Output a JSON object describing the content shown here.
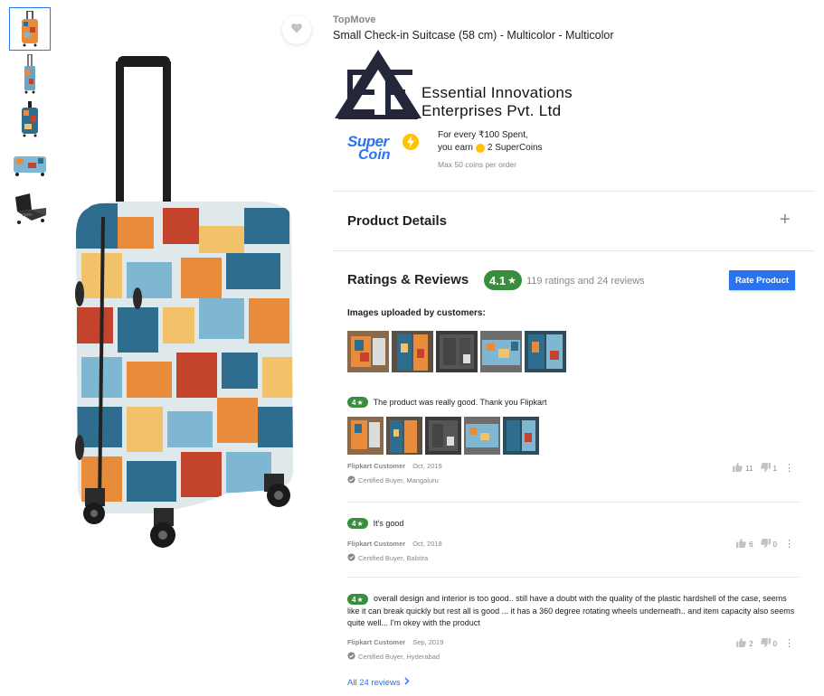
{
  "product": {
    "brand": "TopMove",
    "title": "Small Check-in Suitcase (58 cm) - Multicolor - Multicolor"
  },
  "seller": {
    "name_line1": "Essential Innovations",
    "name_line2": "Enterprises Pvt. Ltd"
  },
  "supercoin": {
    "logo_top": "Super",
    "logo_bottom": "Coin",
    "line1": "For every ₹100 Spent,",
    "line2_prefix": "you earn",
    "line2_suffix": "2 SuperCoins",
    "line3": "Max 50 coins per order"
  },
  "product_details": {
    "title": "Product Details",
    "expand_icon": "+"
  },
  "ratings": {
    "title": "Ratings & Reviews",
    "average": "4.1",
    "star": "★",
    "summary": "119 ratings and 24 reviews",
    "rate_button": "Rate Product",
    "images_label": "Images uploaded by customers:"
  },
  "reviews": [
    {
      "rating": "4",
      "text": "The product was really good. Thank you Flipkart",
      "author": "Flipkart Customer",
      "date": "Oct, 2019",
      "certified": "Certified Buyer, Mangaluru",
      "likes": "11",
      "dislikes": "1"
    },
    {
      "rating": "4",
      "text": "It's good",
      "author": "Flipkart Customer",
      "date": "Oct, 2018",
      "certified": "Certified Buyer, Balotra",
      "likes": "6",
      "dislikes": "0"
    },
    {
      "rating": "4",
      "text": "overall design and interior is too good.. still have a doubt with the quality of the plastic hardshell of the case, seems like it can break quickly but rest all is good ... it has a 360 degree rotating wheels underneath.. and item capacity also seems quite well... I'm okey with the product",
      "author": "Flipkart Customer",
      "date": "Sep, 2019",
      "certified": "Certified Buyer, Hyderabad",
      "likes": "2",
      "dislikes": "0"
    }
  ],
  "all_reviews_link": "All 24 reviews",
  "colors": {
    "accent_blue": "#2874f0",
    "rating_green": "#388e3c",
    "muted_text": "#878787"
  }
}
